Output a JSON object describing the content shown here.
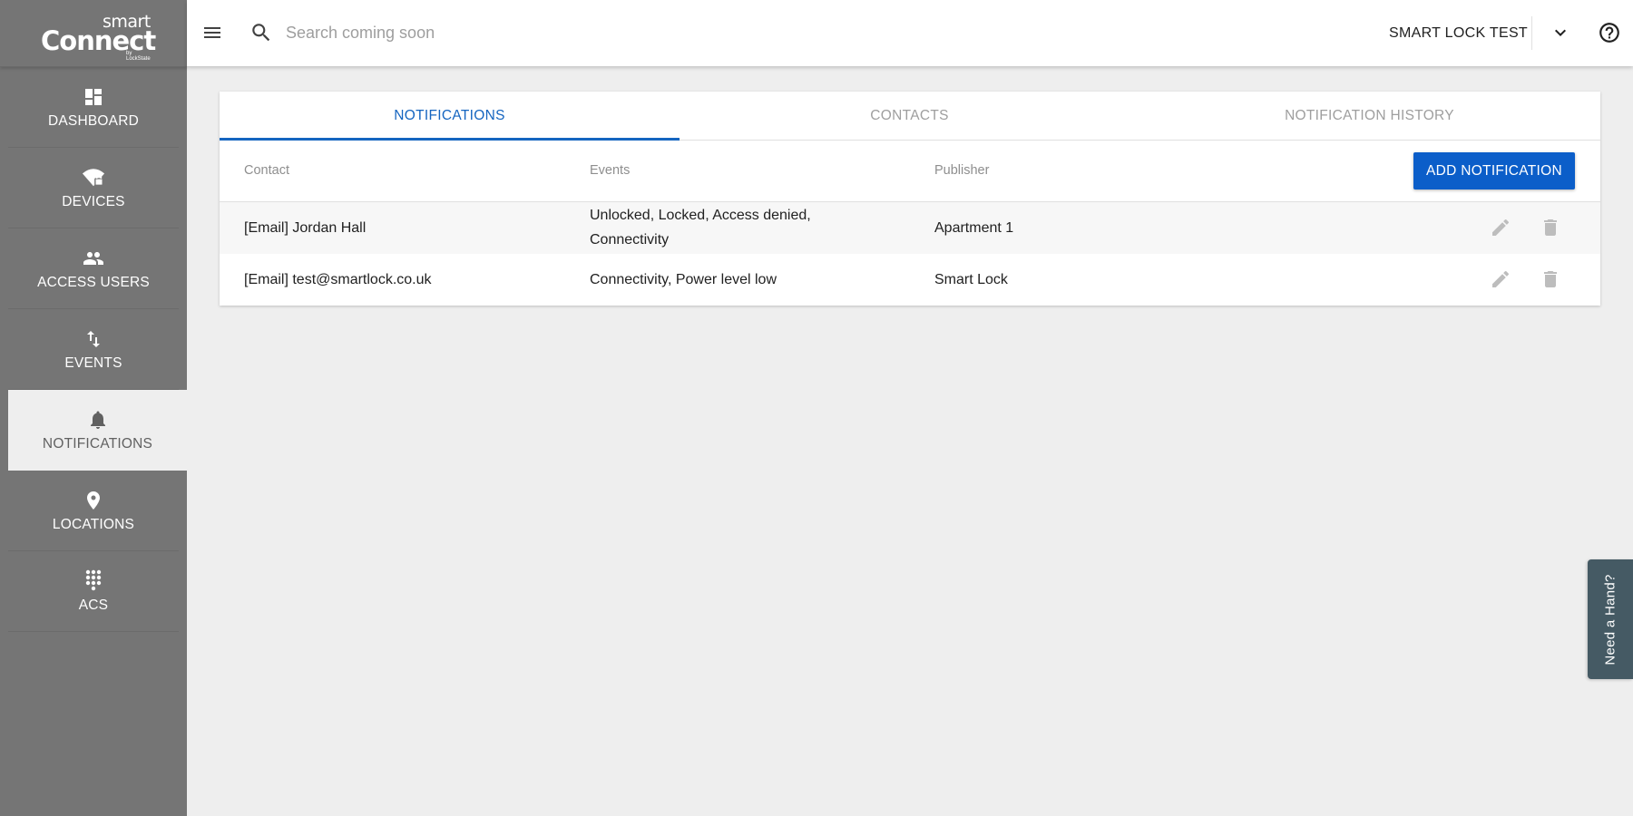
{
  "app": {
    "logo": {
      "top": "smart",
      "main": "Connect",
      "by": "by LockState"
    }
  },
  "sidebar": {
    "items": [
      {
        "label": "DASHBOARD",
        "icon": "dashboard-icon"
      },
      {
        "label": "DEVICES",
        "icon": "wifi-lock-icon"
      },
      {
        "label": "ACCESS USERS",
        "icon": "people-icon"
      },
      {
        "label": "EVENTS",
        "icon": "swap-vert-icon"
      },
      {
        "label": "NOTIFICATIONS",
        "icon": "bell-icon",
        "active": true
      },
      {
        "label": "LOCATIONS",
        "icon": "location-pin-icon"
      },
      {
        "label": "ACS",
        "icon": "dialpad-icon"
      }
    ]
  },
  "header": {
    "search_placeholder": "Search coming soon",
    "account_name": "SMART LOCK TEST"
  },
  "tabs": [
    {
      "label": "NOTIFICATIONS",
      "active": true
    },
    {
      "label": "CONTACTS",
      "active": false
    },
    {
      "label": "NOTIFICATION HISTORY",
      "active": false
    }
  ],
  "table": {
    "columns": [
      "Contact",
      "Events",
      "Publisher"
    ],
    "add_button": "ADD NOTIFICATION",
    "rows": [
      {
        "contact": "[Email] Jordan Hall",
        "events_line1": "Unlocked, Locked, Access denied,",
        "events_line2": "Connectivity",
        "publisher": "Apartment 1"
      },
      {
        "contact": "[Email] test@smartlock.co.uk",
        "events_line1": "Connectivity, Power level low",
        "events_line2": "",
        "publisher": "Smart Lock"
      }
    ]
  },
  "help_tab": {
    "label": "Need a Hand?"
  },
  "colors": {
    "sidebar": "#757575",
    "accent": "#1565c0",
    "button": "#0b5ec9",
    "help_tab": "#455a64",
    "background": "#eeeeee"
  }
}
